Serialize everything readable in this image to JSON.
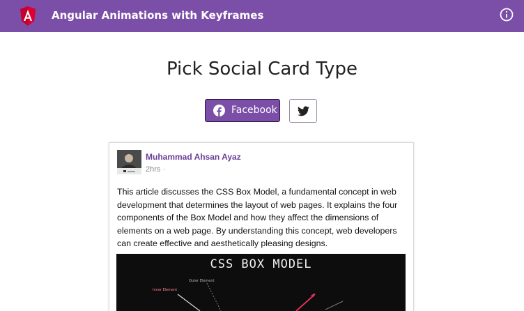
{
  "header": {
    "title": "Angular Animations with Keyframes",
    "logo_icon": "angular-logo-icon",
    "info_icon": "info-icon",
    "background_color": "#7b4ea8"
  },
  "main": {
    "heading": "Pick Social Card Type",
    "card_type_buttons": [
      {
        "label": "Facebook",
        "icon": "facebook-icon",
        "selected": true
      },
      {
        "label": "",
        "icon": "twitter-icon",
        "selected": false
      }
    ]
  },
  "card": {
    "author": "Muhammad Ahsan Ayaz",
    "timestamp": "2hrs ·",
    "text": "This article discusses the CSS Box Model, a fundamental concept in web development that determines the layout of web pages. It explains the four components of the Box Model and how they affect the dimensions of elements on a web page. By understanding this concept, web developers can create effective and aesthetically pleasing designs.",
    "image": {
      "title": "CSS BOX MODEL",
      "label_outer": "Outer Element",
      "label_inner": "Inner Element"
    }
  },
  "colors": {
    "accent": "#7b4ea8",
    "author_link": "#6a3f96"
  }
}
